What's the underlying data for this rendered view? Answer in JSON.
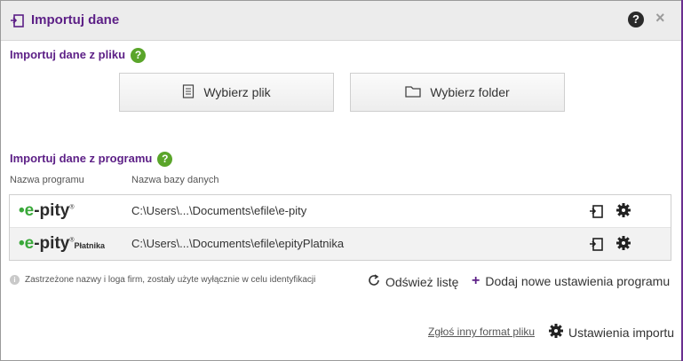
{
  "dialog": {
    "title": "Importuj dane",
    "help_label": "?",
    "close_label": "×"
  },
  "file_section": {
    "heading": "Importuj dane z pliku",
    "help_label": "?",
    "choose_file_label": "Wybierz plik",
    "choose_folder_label": "Wybierz folder"
  },
  "program_section": {
    "heading": "Importuj dane z programu",
    "help_label": "?",
    "columns": [
      "Nazwa programu",
      "Nazwa bazy danych"
    ],
    "rows": [
      {
        "logo_prefix": "e",
        "logo_text": "-pity",
        "logo_mark": "®",
        "logo_suffix": "",
        "path": "C:\\Users\\...\\Documents\\efile\\e-pity"
      },
      {
        "logo_prefix": "e",
        "logo_text": "-pity",
        "logo_mark": "®",
        "logo_suffix": "Płatnika",
        "path": "C:\\Users\\...\\Documents\\efile\\epityPlatnika"
      }
    ]
  },
  "footer": {
    "disclaimer": "Zastrzeżone nazwy i loga firm, zostały użyte wyłącznie w celu identyfikacji",
    "refresh_label": "Odśwież listę",
    "add_label": "Dodaj nowe ustawienia programu",
    "report_label": "Zgłoś inny format pliku",
    "settings_label": "Ustawienia importu"
  },
  "colors": {
    "accent": "#5c1f86",
    "help_green": "#5aa52a",
    "logo_green": "#3aa83a"
  }
}
